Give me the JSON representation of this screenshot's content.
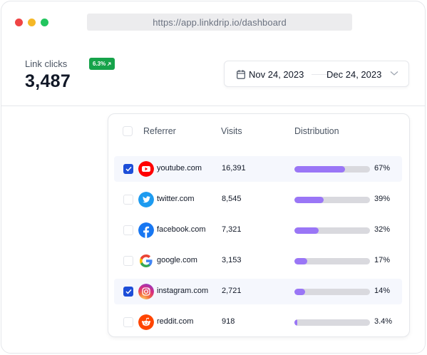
{
  "browser": {
    "url": "https://app.linkdrip.io/dashboard"
  },
  "metric": {
    "label": "Link clicks",
    "value": "3,487",
    "badge": "6.3%",
    "badge_color": "#16a34a"
  },
  "date_range": {
    "from": "Nov 24, 2023",
    "to": "Dec 24, 2023"
  },
  "table": {
    "headers": {
      "referrer": "Referrer",
      "visits": "Visits",
      "distribution": "Distribution"
    },
    "rows": [
      {
        "domain": "youtube.com",
        "visits": "16,391",
        "percent": "67%",
        "share": 0.67,
        "checked": true,
        "icon": "youtube-icon"
      },
      {
        "domain": "twitter.com",
        "visits": "8,545",
        "percent": "39%",
        "share": 0.39,
        "checked": false,
        "icon": "twitter-icon"
      },
      {
        "domain": "facebook.com",
        "visits": "7,321",
        "percent": "32%",
        "share": 0.32,
        "checked": false,
        "icon": "facebook-icon"
      },
      {
        "domain": "google.com",
        "visits": "3,153",
        "percent": "17%",
        "share": 0.17,
        "checked": false,
        "icon": "google-icon"
      },
      {
        "domain": "instagram.com",
        "visits": "2,721",
        "percent": "14%",
        "share": 0.14,
        "checked": true,
        "icon": "instagram-icon"
      },
      {
        "domain": "reddit.com",
        "visits": "918",
        "percent": "3.4%",
        "share": 0.034,
        "checked": false,
        "icon": "reddit-icon"
      }
    ]
  },
  "colors": {
    "accent": "#9a76f6",
    "checkbox": "#1d4ed8"
  }
}
